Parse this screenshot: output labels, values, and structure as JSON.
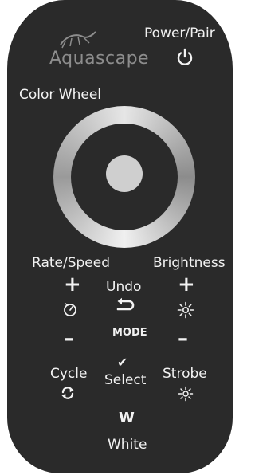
{
  "remote": {
    "brand": "Aquascape",
    "power_label": "Power/Pair",
    "color_wheel_label": "Color Wheel",
    "rate_speed_label": "Rate/Speed",
    "brightness_label": "Brightness",
    "undo_label": "Undo",
    "mode_label": "MODE",
    "cycle_label": "Cycle",
    "select_label": "Select",
    "strobe_label": "Strobe",
    "white_symbol": "W",
    "white_label": "White",
    "plus_symbol": "+",
    "minus_symbol": "–",
    "checkmark_symbol": "✔"
  },
  "icons": {
    "power": "power-icon",
    "speed": "timer-icon",
    "brightness": "sun-icon",
    "undo": "undo-arrow-icon",
    "cycle": "cycle-arrows-icon",
    "strobe": "strobe-icon",
    "logo": "salamander-logo-icon"
  },
  "colors": {
    "body": "#2a2a2a",
    "text": "#f2f2f2",
    "logo": "#8d8d8d",
    "wheel_light": "#e6e6e6",
    "wheel_dark": "#8c8c8c",
    "center_button": "#cfcfcf"
  }
}
